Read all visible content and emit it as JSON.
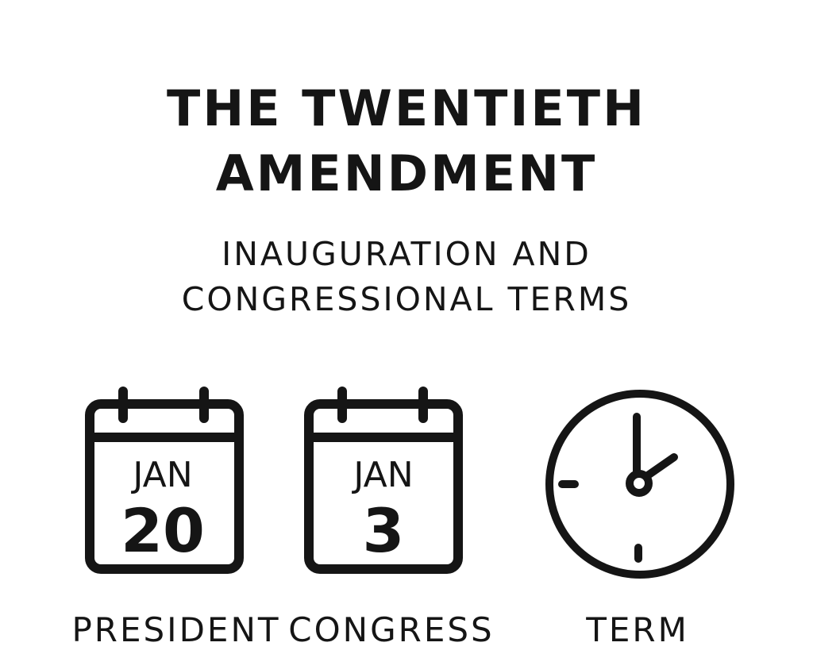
{
  "title": {
    "line1": "THE TWENTIETH",
    "line2": "AMENDMENT"
  },
  "subtitle": {
    "line1": "INAUGURATION AND",
    "line2": "CONGRESSIONAL TERMS"
  },
  "items": [
    {
      "icon": "calendar-icon",
      "month": "JAN",
      "day": "20",
      "label": "PRESIDENT"
    },
    {
      "icon": "calendar-icon",
      "month": "JAN",
      "day": "3",
      "label": "CONGRESS"
    },
    {
      "icon": "clock-icon",
      "label": "TERM"
    }
  ],
  "colors": {
    "ink": "#151515",
    "background": "#ffffff"
  }
}
